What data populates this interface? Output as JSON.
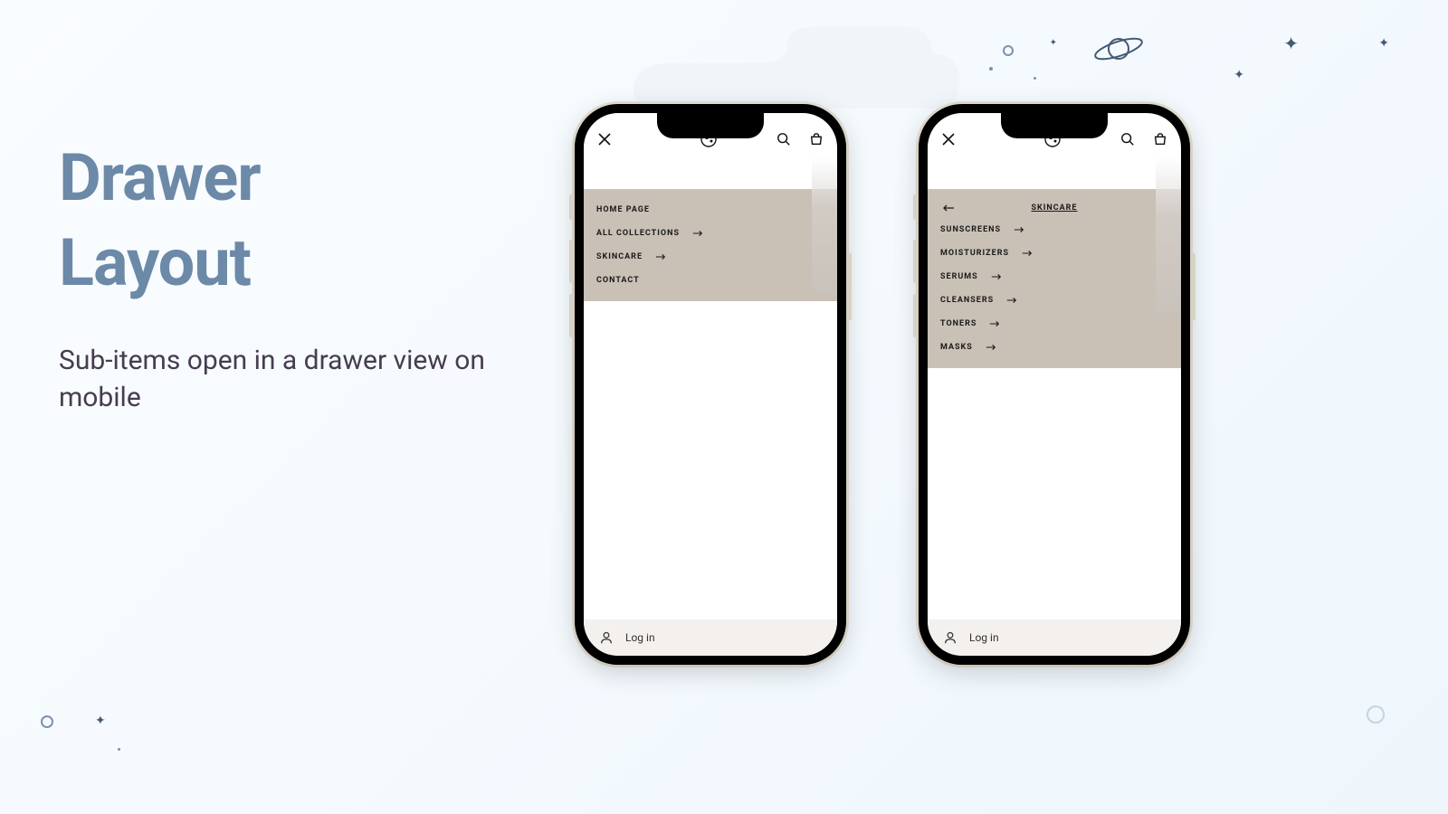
{
  "title_line1": "Drawer",
  "title_line2": "Layout",
  "subtitle": "Sub-items open in a drawer view on mobile",
  "phone1": {
    "menu": [
      {
        "label": "HOME PAGE",
        "arrow": false
      },
      {
        "label": "ALL COLLECTIONS",
        "arrow": true
      },
      {
        "label": "SKINCARE",
        "arrow": true
      },
      {
        "label": "CONTACT",
        "arrow": false
      }
    ],
    "login": "Log in"
  },
  "phone2": {
    "subheader": "SKINCARE",
    "menu": [
      {
        "label": "SUNSCREENS",
        "arrow": true
      },
      {
        "label": "MOISTURIZERS",
        "arrow": true
      },
      {
        "label": "SERUMS",
        "arrow": true
      },
      {
        "label": "CLEANSERS",
        "arrow": true
      },
      {
        "label": "TONERS",
        "arrow": true
      },
      {
        "label": "MASKS",
        "arrow": true
      }
    ],
    "login": "Log in"
  }
}
